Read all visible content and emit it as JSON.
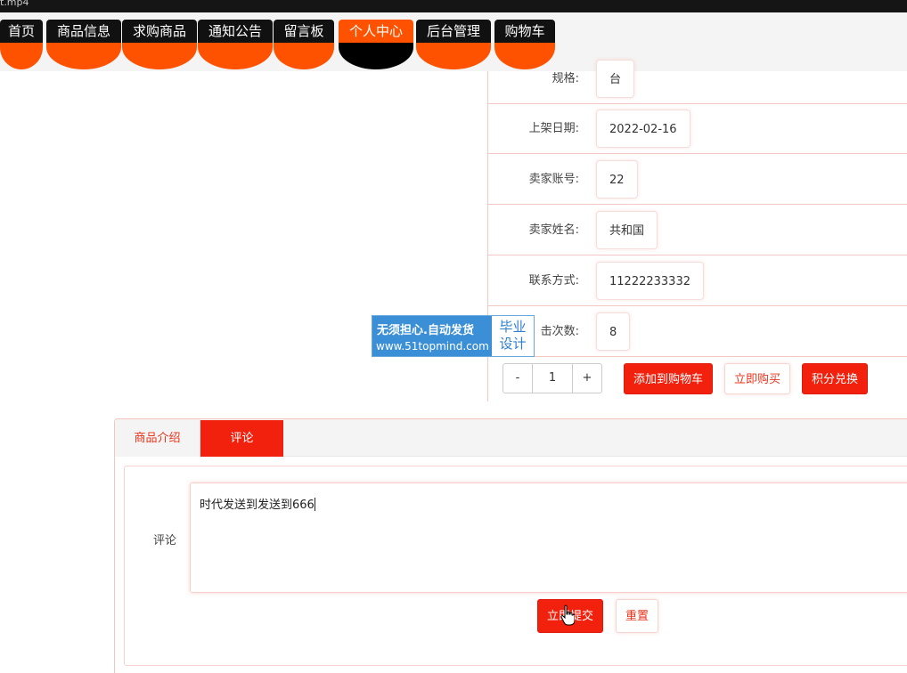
{
  "window": {
    "title_fragment": "t.mp4"
  },
  "nav": {
    "items": [
      {
        "label": "首页",
        "active": false
      },
      {
        "label": "商品信息",
        "active": false
      },
      {
        "label": "求购商品",
        "active": false
      },
      {
        "label": "通知公告",
        "active": false
      },
      {
        "label": "留言板",
        "active": false
      },
      {
        "label": "个人中心",
        "active": true
      },
      {
        "label": "后台管理",
        "active": false
      },
      {
        "label": "购物车",
        "active": false
      }
    ]
  },
  "details": {
    "rows": [
      {
        "label": "规格:",
        "value": "台"
      },
      {
        "label": "上架日期:",
        "value": "2022-02-16"
      },
      {
        "label": "卖家账号:",
        "value": "22"
      },
      {
        "label": "卖家姓名:",
        "value": "共和国"
      },
      {
        "label": "联系方式:",
        "value": "11222233332"
      },
      {
        "label": "击次数:",
        "value": "8"
      }
    ],
    "quantity": {
      "minus": "-",
      "value": "1",
      "plus": "+"
    },
    "actions": {
      "add_to_cart": "添加到购物车",
      "buy_now": "立即购买",
      "redeem_points": "积分兑换"
    }
  },
  "watermark": {
    "line1": "无须担心.自动发货",
    "line2": "www.51topmind.com",
    "side_line1": "毕业",
    "side_line2": "设计"
  },
  "tabs": {
    "items": [
      {
        "label": "商品介绍",
        "active": false
      },
      {
        "label": "评论",
        "active": true
      }
    ]
  },
  "comment": {
    "label": "评论",
    "text": "时代发送到发送到666",
    "submit_label": "立即提交",
    "reset_label": "重置"
  },
  "colors": {
    "accent": "#f2210e",
    "nav_orange": "#ff5200",
    "nav_black": "#111111"
  }
}
